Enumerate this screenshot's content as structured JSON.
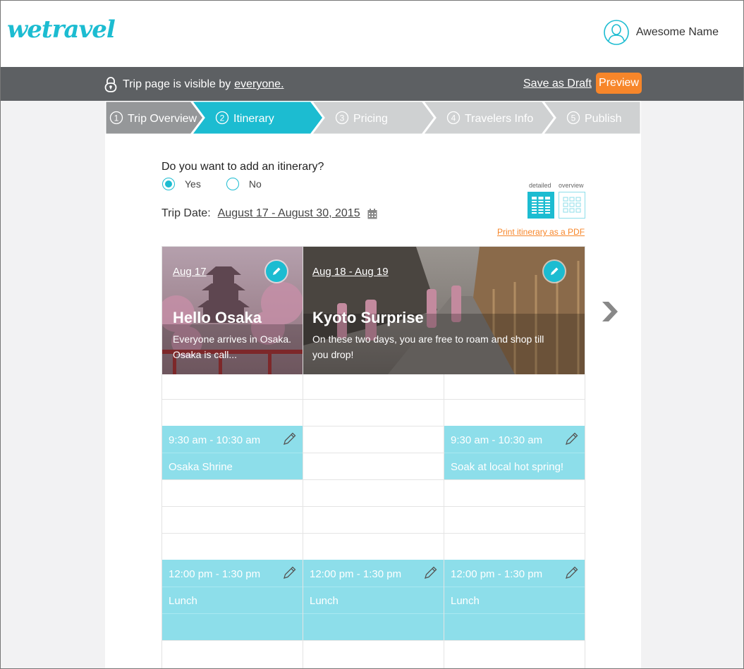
{
  "header": {
    "logo": "wetravel",
    "user_name": "Awesome Name"
  },
  "topbar": {
    "visibility_prefix": "Trip page is visible by",
    "visibility_link": "everyone.",
    "save_draft": "Save as Draft",
    "preview": "Preview"
  },
  "steps": [
    {
      "num": "1",
      "label": "Trip Overview",
      "state": "done"
    },
    {
      "num": "2",
      "label": "Itinerary",
      "state": "active"
    },
    {
      "num": "3",
      "label": "Pricing",
      "state": "todo"
    },
    {
      "num": "4",
      "label": "Travelers Info",
      "state": "todo"
    },
    {
      "num": "5",
      "label": "Publish",
      "state": "todo"
    }
  ],
  "form": {
    "question": "Do you want to add an itinerary?",
    "yes": "Yes",
    "no": "No",
    "selected": "Yes",
    "trip_date_label": "Trip Date:",
    "trip_date_value": "August 17 - August 30, 2015"
  },
  "view_toggle": {
    "detailed": "detailed",
    "overview": "overview",
    "selected": "detailed"
  },
  "print_link": "Print itinerary as a PDF",
  "days": [
    {
      "date": "Aug 17",
      "title": "Hello Osaka",
      "desc_line1": "Everyone arrives in Osaka.",
      "desc_line2": "Osaka is call..."
    },
    {
      "date": "Aug 18 - Aug 19",
      "title": "Kyoto Surprise",
      "desc_line1": "On these two days, you are free to roam and shop till",
      "desc_line2": "you drop!"
    }
  ],
  "events": [
    {
      "time": "9:30 am - 10:30 am",
      "title": "Osaka Shrine"
    },
    {
      "time": "9:30 am - 10:30 am",
      "title": "Soak at local hot spring!"
    },
    {
      "time": "12:00 pm - 1:30 pm",
      "title": "Lunch"
    },
    {
      "time": "12:00 pm - 1:30 pm",
      "title": "Lunch"
    },
    {
      "time": "12:00 pm - 1:30 pm",
      "title": "Lunch"
    }
  ],
  "colors": {
    "accent": "#1cbcd1",
    "orange": "#f7862a",
    "topbar": "#5d6063",
    "event": "#8ddeea"
  }
}
